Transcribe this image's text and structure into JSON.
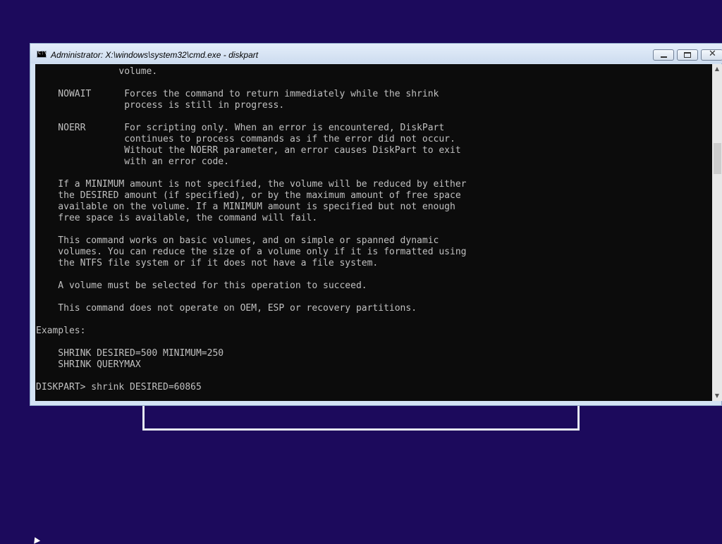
{
  "window": {
    "title": "Administrator: X:\\windows\\system32\\cmd.exe - diskpart",
    "icon_label": "C:\\",
    "icon": "cmd-icon",
    "minimize_icon": "minimize-icon",
    "maximize_icon": "maximize-icon",
    "close_icon": "close-icon",
    "close_glyph": "✕"
  },
  "console": {
    "lines": [
      "               volume.",
      "",
      "    NOWAIT      Forces the command to return immediately while the shrink",
      "                process is still in progress.",
      "",
      "    NOERR       For scripting only. When an error is encountered, DiskPart",
      "                continues to process commands as if the error did not occur.",
      "                Without the NOERR parameter, an error causes DiskPart to exit",
      "                with an error code.",
      "",
      "    If a MINIMUM amount is not specified, the volume will be reduced by either",
      "    the DESIRED amount (if specified), or by the maximum amount of free space",
      "    available on the volume. If a MINIMUM amount is specified but not enough",
      "    free space is available, the command will fail.",
      "",
      "    This command works on basic volumes, and on simple or spanned dynamic",
      "    volumes. You can reduce the size of a volume only if it is formatted using",
      "    the NTFS file system or if it does not have a file system.",
      "",
      "    A volume must be selected for this operation to succeed.",
      "",
      "    This command does not operate on OEM, ESP or recovery partitions.",
      "",
      "Examples:",
      "",
      "    SHRINK DESIRED=500 MINIMUM=250",
      "    SHRINK QUERYMAX",
      "",
      "DISKPART> shrink DESIRED=60865"
    ]
  },
  "scrollbar": {
    "up_glyph": "▲",
    "down_glyph": "▼"
  },
  "colors": {
    "desktop": "#1c0a5c",
    "console_bg": "#0c0c0c",
    "console_fg": "#c0c0c0",
    "frame": "#d4e3f4"
  }
}
